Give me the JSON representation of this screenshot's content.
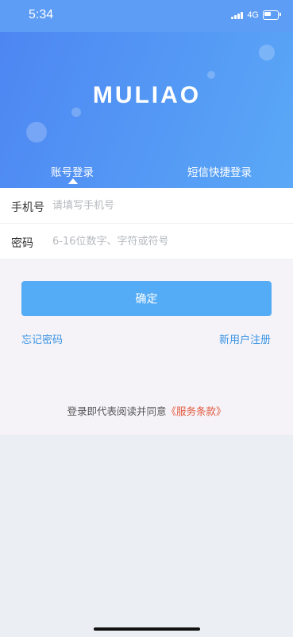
{
  "status_bar": {
    "time": "5:34",
    "network": "4G"
  },
  "header": {
    "logo_text": "MULIAO",
    "tabs": [
      {
        "label": "账号登录",
        "active": true
      },
      {
        "label": "短信快捷登录",
        "active": false
      }
    ]
  },
  "form": {
    "phone": {
      "label": "手机号",
      "placeholder": "请填写手机号"
    },
    "password": {
      "label": "密码",
      "placeholder": "6-16位数字、字符或符号"
    }
  },
  "actions": {
    "confirm_label": "确定",
    "forgot_label": "忘记密码",
    "register_label": "新用户注册"
  },
  "agreement": {
    "text": "登录即代表阅读并同意",
    "link_text": "《服务条款》"
  },
  "icons": [
    "signal-icon",
    "battery-icon"
  ],
  "colors": {
    "header_gradient_start": "#4d86f2",
    "header_gradient_end": "#5aa8f7",
    "button": "#55acf6",
    "link": "#3a94e3",
    "terms_link": "#e2573b"
  }
}
